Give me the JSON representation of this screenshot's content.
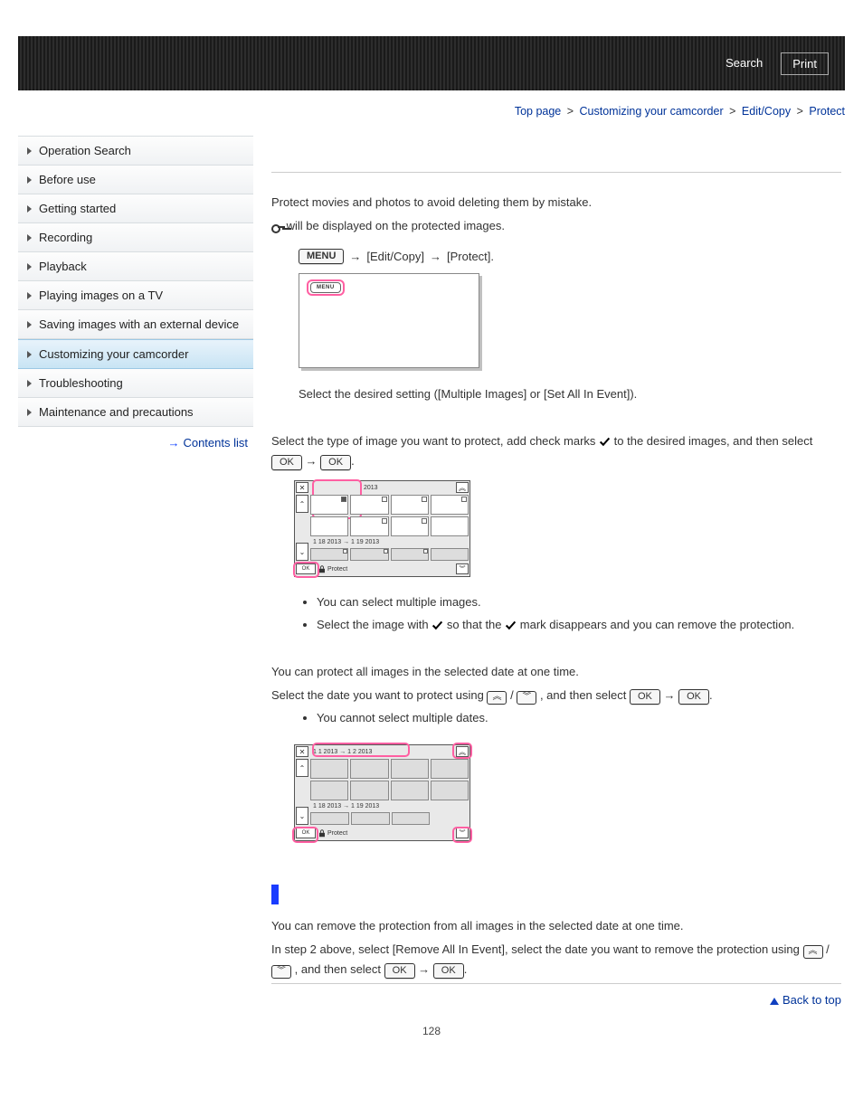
{
  "header": {
    "search_label": "Search",
    "print_label": "Print"
  },
  "breadcrumb": {
    "items": [
      "Top page",
      "Customizing your camcorder",
      "Edit/Copy"
    ],
    "current": "Protect",
    "sep": ">"
  },
  "sidebar": {
    "items": [
      {
        "label": "Operation Search",
        "selected": false
      },
      {
        "label": "Before use",
        "selected": false
      },
      {
        "label": "Getting started",
        "selected": false
      },
      {
        "label": "Recording",
        "selected": false
      },
      {
        "label": "Playback",
        "selected": false
      },
      {
        "label": "Playing images on a TV",
        "selected": false
      },
      {
        "label": "Saving images with an external device",
        "selected": false
      },
      {
        "label": "Customizing your camcorder",
        "selected": true
      },
      {
        "label": "Troubleshooting",
        "selected": false
      },
      {
        "label": "Maintenance and precautions",
        "selected": false
      }
    ],
    "contents_link": "Contents list"
  },
  "content": {
    "intro1": "Protect movies and photos to avoid deleting them by mistake.",
    "intro2": " will be displayed on the protected images.",
    "menu_btn": "MENU",
    "path_edit": "[Edit/Copy]",
    "path_protect": "[Protect].",
    "screenshot_menu_label": "MENU",
    "step2_text": "Select the desired setting ([Multiple Images] or [Set All In Event]).",
    "step3_pre": "Select the type of image you want to protect, add check marks ",
    "step3_mid": " to the desired images, and then select ",
    "ok_label": "OK",
    "period": ".",
    "slash": " / ",
    "ss2_dates_top": "2013",
    "ss2_dates_mid": "1 18 2013 → 1 19 2013",
    "ss2_protect_label": "Protect",
    "bullets_a": [
      "You can select multiple images."
    ],
    "bullet_a2_pre": "Select the image with ",
    "bullet_a2_mid": " so that the ",
    "bullet_a2_post": " mark disappears and you can remove the protection.",
    "setall_para": "You can protect all images in the selected date at one time.",
    "setall_line_pre": "Select the date you want to protect using ",
    "setall_line_mid": ", and then select ",
    "bullets_b": [
      "You cannot select multiple dates."
    ],
    "ss3_dates_top": "1 1 2013 → 1 2 2013",
    "remove_para1": "You can remove the protection from all images in the selected date at one time.",
    "remove_para2_pre": "In step 2 above, select [Remove All In Event], select the date you want to remove the protection using ",
    "remove_para2_mid": ", and then select ",
    "back_to_top": "Back to top",
    "page_number": "128"
  }
}
